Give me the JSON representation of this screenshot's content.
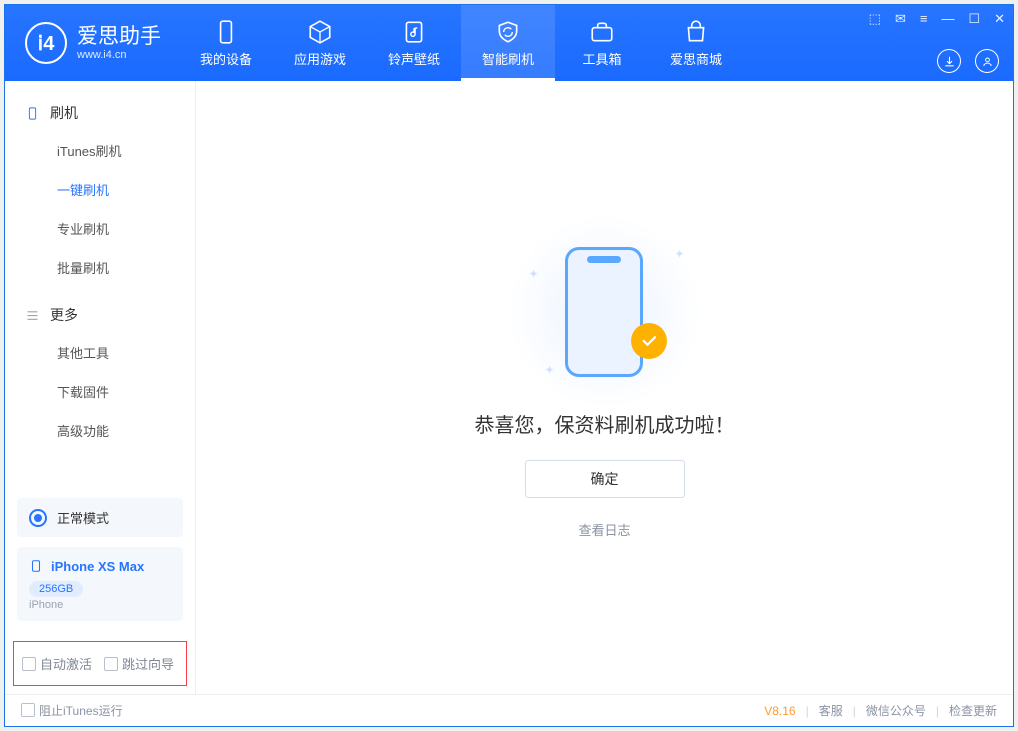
{
  "brand": {
    "title": "爱思助手",
    "sub": "www.i4.cn"
  },
  "tabs": [
    {
      "label": "我的设备"
    },
    {
      "label": "应用游戏"
    },
    {
      "label": "铃声壁纸"
    },
    {
      "label": "智能刷机"
    },
    {
      "label": "工具箱"
    },
    {
      "label": "爱思商城"
    }
  ],
  "sidebar": {
    "section1": {
      "title": "刷机",
      "items": [
        "iTunes刷机",
        "一键刷机",
        "专业刷机",
        "批量刷机"
      ]
    },
    "section2": {
      "title": "更多",
      "items": [
        "其他工具",
        "下载固件",
        "高级功能"
      ]
    },
    "mode": "正常模式",
    "device": {
      "name": "iPhone XS Max",
      "capacity": "256GB",
      "type": "iPhone"
    },
    "foot": {
      "opt1": "自动激活",
      "opt2": "跳过向导"
    }
  },
  "content": {
    "message": "恭喜您，保资料刷机成功啦！",
    "ok": "确定",
    "log": "查看日志"
  },
  "status": {
    "block_itunes": "阻止iTunes运行",
    "version": "V8.16",
    "links": [
      "客服",
      "微信公众号",
      "检查更新"
    ]
  }
}
